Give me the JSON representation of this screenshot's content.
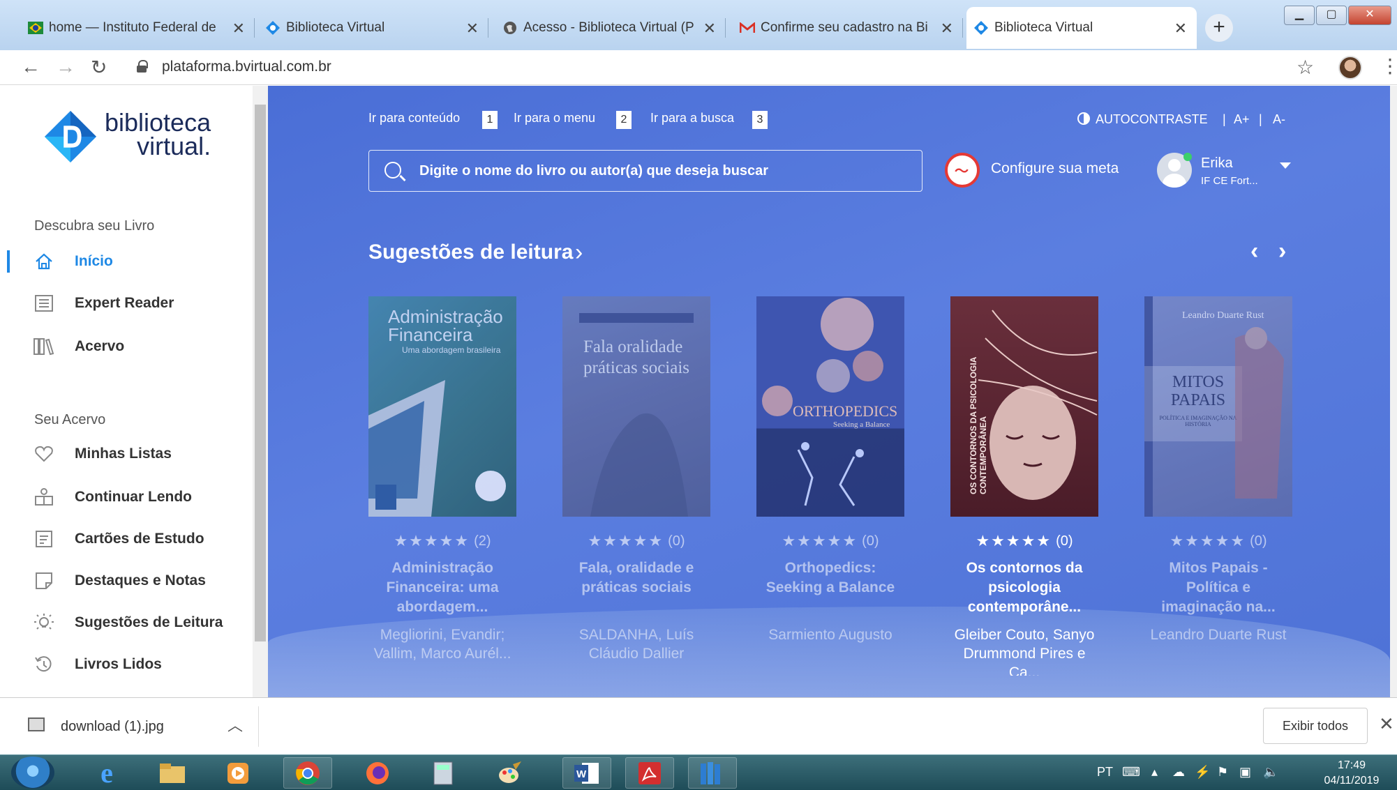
{
  "browser": {
    "tabs": [
      {
        "title": "home — Instituto Federal de",
        "icon": "ifce-flag-icon",
        "active": false
      },
      {
        "title": "Biblioteca Virtual",
        "icon": "bvirtual-logo-icon",
        "active": false
      },
      {
        "title": "Acesso - Biblioteca Virtual (P",
        "icon": "globe-icon",
        "active": false
      },
      {
        "title": "Confirme seu cadastro na Bi",
        "icon": "gmail-icon",
        "active": false
      },
      {
        "title": "Biblioteca Virtual",
        "icon": "bvirtual-logo-icon",
        "active": true
      }
    ],
    "new_tab": "+",
    "url": "plataforma.bvirtual.com.br"
  },
  "sidebar": {
    "logo_line1": "biblioteca",
    "logo_line2": "virtual.",
    "section1": "Descubra seu Livro",
    "discover_items": [
      {
        "label": "Início",
        "icon": "home-icon",
        "active": true
      },
      {
        "label": "Expert Reader",
        "icon": "list-icon",
        "active": false
      },
      {
        "label": "Acervo",
        "icon": "books-icon",
        "active": false
      }
    ],
    "section2": "Seu Acervo",
    "collection_items": [
      {
        "label": "Minhas Listas",
        "icon": "heart-icon"
      },
      {
        "label": "Continuar Lendo",
        "icon": "reading-icon"
      },
      {
        "label": "Cartões de Estudo",
        "icon": "card-icon"
      },
      {
        "label": "Destaques e Notas",
        "icon": "note-icon"
      },
      {
        "label": "Sugestões de Leitura",
        "icon": "bulb-icon"
      },
      {
        "label": "Livros Lidos",
        "icon": "history-icon"
      }
    ]
  },
  "header": {
    "skip_links": [
      {
        "label": "Ir para conteúdo",
        "num": "1"
      },
      {
        "label": "Ir para o menu",
        "num": "2"
      },
      {
        "label": "Ir para a busca",
        "num": "3"
      }
    ],
    "autocontrast": "AUTOCONTRASTE",
    "font_up": "A+",
    "font_down": "A-",
    "search_placeholder": "Digite o nome do livro ou autor(a) que deseja buscar",
    "goal_label": "Configure sua meta",
    "user_name": "Erika",
    "user_institution": "IF CE Fort..."
  },
  "suggestions": {
    "title": "Sugestões de leitura",
    "books": [
      {
        "cover_title": "Administração Financeira",
        "cover_subtitle": "Uma abordagem brasileira",
        "rating_stars": 5,
        "rating_count": "(2)",
        "title": "Administração Financeira: uma abordagem...",
        "author": "Megliorini, Evandir; Vallim, Marco Aurél...",
        "highlight": false
      },
      {
        "cover_title": "Fala oralidade práticas sociais",
        "cover_subtitle": "",
        "rating_stars": 5,
        "rating_count": "(0)",
        "title": "Fala, oralidade e práticas sociais",
        "author": "SALDANHA, Luís Cláudio Dallier",
        "highlight": false
      },
      {
        "cover_title": "ORTHOPEDICS",
        "cover_subtitle": "Seeking a Balance",
        "rating_stars": 5,
        "rating_count": "(0)",
        "title": "Orthopedics: Seeking a Balance",
        "author": "Sarmiento Augusto",
        "highlight": false
      },
      {
        "cover_title": "OS CONTORNOS DA PSICOLOGIA CONTEMPORÂNEA",
        "cover_subtitle": "",
        "rating_stars": 5,
        "rating_count": "(0)",
        "title": "Os contornos da psicologia contemporâne...",
        "author": "Gleiber Couto, Sanyo Drummond Pires e Ca...",
        "highlight": true
      },
      {
        "cover_title": "MITOS PAPAIS",
        "cover_subtitle": "POLÍTICA E IMAGINAÇÃO NA HISTÓRIA",
        "cover_author": "Leandro Duarte Rust",
        "rating_stars": 5,
        "rating_count": "(0)",
        "title": "Mitos Papais - Política e imaginação na...",
        "author": "Leandro Duarte Rust",
        "highlight": false
      }
    ]
  },
  "download_shelf": {
    "file": "download (1).jpg",
    "show_all": "Exibir todos"
  },
  "taskbar": {
    "lang": "PT",
    "time": "17:49",
    "date": "04/11/2019"
  }
}
